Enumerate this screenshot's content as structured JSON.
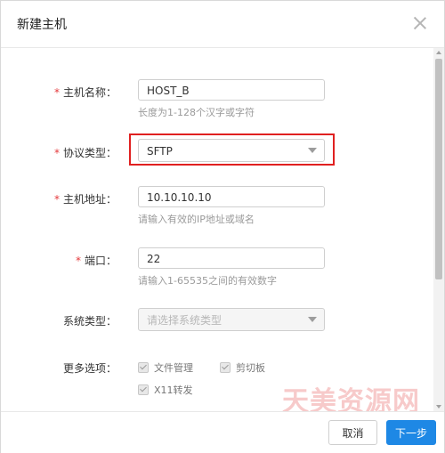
{
  "dialog": {
    "title": "新建主机",
    "close_icon": "close-icon"
  },
  "form": {
    "host_name": {
      "label": "主机名称：",
      "value": "HOST_B",
      "hint": "长度为1-128个汉字或字符",
      "required": true
    },
    "protocol": {
      "label": "协议类型：",
      "value": "SFTP",
      "required": true
    },
    "host_address": {
      "label": "主机地址：",
      "value": "10.10.10.10",
      "hint": "请输入有效的IP地址或域名",
      "required": true
    },
    "port": {
      "label": "端口：",
      "value": "22",
      "hint": "请输入1-65535之间的有效数字",
      "required": true
    },
    "system_type": {
      "label": "系统类型：",
      "placeholder": "请选择系统类型",
      "required": false
    },
    "more_options": {
      "label": "更多选项：",
      "options": [
        {
          "label": "文件管理",
          "checked": true
        },
        {
          "label": "剪切板",
          "checked": true
        },
        {
          "label": "X11转发",
          "checked": true
        }
      ]
    }
  },
  "footer": {
    "cancel_label": "取消",
    "next_label": "下一步"
  },
  "required_mark": "*",
  "watermark": "天美资源网",
  "colors": {
    "primary": "#1e88e5",
    "required": "#e4393c",
    "highlight": "#e02020"
  }
}
